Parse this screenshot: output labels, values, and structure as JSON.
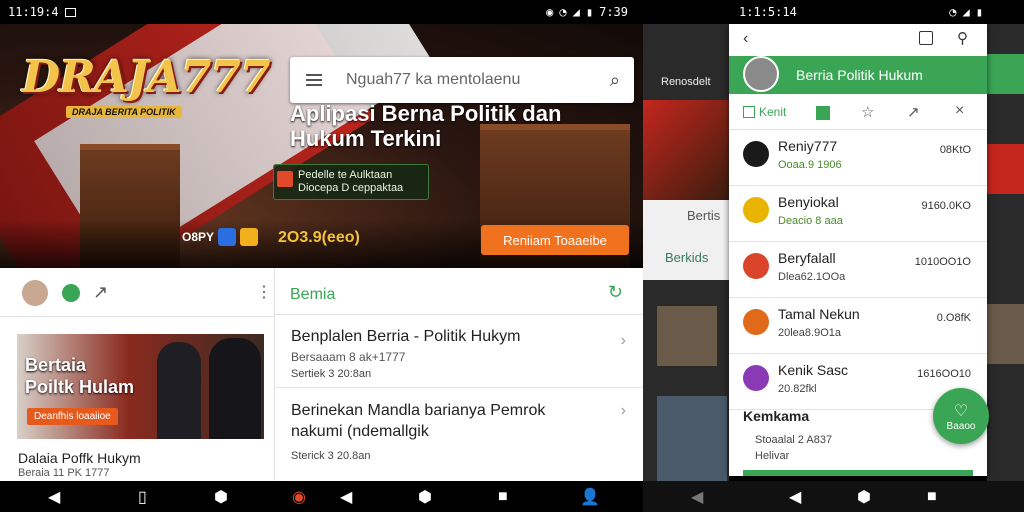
{
  "status_left": {
    "time": "11:19:4"
  },
  "status_mid": {
    "time": "7:39"
  },
  "status_right": {
    "time": "1:1:5:14"
  },
  "hero": {
    "logo": "DRAJA777",
    "logo_sub": "DRAJA BERITA POLITIK",
    "search_placeholder": "Nguah77 ka mentolaenu",
    "title": "Aplipasi Berna Politik dan Hukum Terkini",
    "promo_text": "Pedelle te Aulktaan Diocepa D ceppaktaa",
    "badge_text": "O8PY",
    "year_text": "2O3.9(eeo)",
    "read_button": "Reniiam Toaaeibe"
  },
  "left_panel": {
    "card_title": "Bertaia Poiltk Hulam",
    "card_button": "Deanfhis loaaiioe",
    "caption": "Dalaia Poffk Hukym",
    "sub": "Beraia 11 PK 1777"
  },
  "middle_panel": {
    "header": "Bemia",
    "articles": [
      {
        "title": "Benplalen Berria - Politik Hukym",
        "meta": "Bersaaam 8 ak+1777",
        "date": "Sertiek 3 20:8an"
      },
      {
        "title": "Berinekan Mandla barianya Pemrok nakumi (ndemallgik",
        "meta": "",
        "date": "Sterick 3 20.8an"
      }
    ]
  },
  "far_right": {
    "label1": "Renosdelt",
    "label2": "Bertis",
    "label3": "Berkids"
  },
  "phone2": {
    "header": "Berria Politik Hukum",
    "tab_label": "Kenit",
    "rows": [
      {
        "name": "Reniy777",
        "sub": "Ooaa.9 1906",
        "time": "08KtO",
        "color": "#1a1a1a"
      },
      {
        "name": "Benyiokal",
        "sub": "Deacio 8 aaa",
        "time": "9160.0KO",
        "color": "#e8b400"
      },
      {
        "name": "Beryfalall",
        "sub": "Dlea62.1OOa",
        "time": "1010OO1O",
        "color": "#d9442a"
      },
      {
        "name": "Tamal Nekun",
        "sub": "20lea8.9O1a",
        "time": "0.O8fK",
        "color": "#e06a1a"
      },
      {
        "name": "Kenik Sasc",
        "sub": "20.82fkl",
        "time": "1616OO10",
        "color": "#8a3ab5"
      }
    ],
    "footer_title": "Kemkama",
    "footer_line1": "Stoaalal 2 A837",
    "footer_line2": "Helivar",
    "fab_label": "Baaoo"
  },
  "colors": {
    "accent_green": "#3aa655",
    "orange": "#f0711e"
  }
}
